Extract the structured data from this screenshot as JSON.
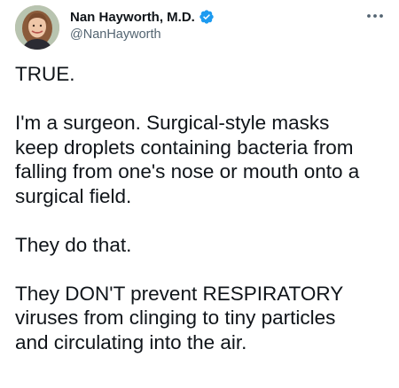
{
  "author": {
    "display_name": "Nan Hayworth, M.D.",
    "handle": "@NanHayworth",
    "verified": true,
    "avatar_icon": "profile-photo"
  },
  "menu": {
    "more_icon": "more-horizontal-icon"
  },
  "tweet": {
    "paragraphs": [
      "TRUE.",
      "I'm a surgeon. Surgical-style masks\nkeep droplets containing bacteria from\nfalling from one's nose or mouth onto a\nsurgical field.",
      "They do that.",
      "They DON'T prevent RESPIRATORY\nviruses from clinging to tiny particles\nand circulating into the air."
    ]
  },
  "colors": {
    "text": "#0f1419",
    "secondary": "#536471",
    "verified": "#1d9bf0"
  }
}
